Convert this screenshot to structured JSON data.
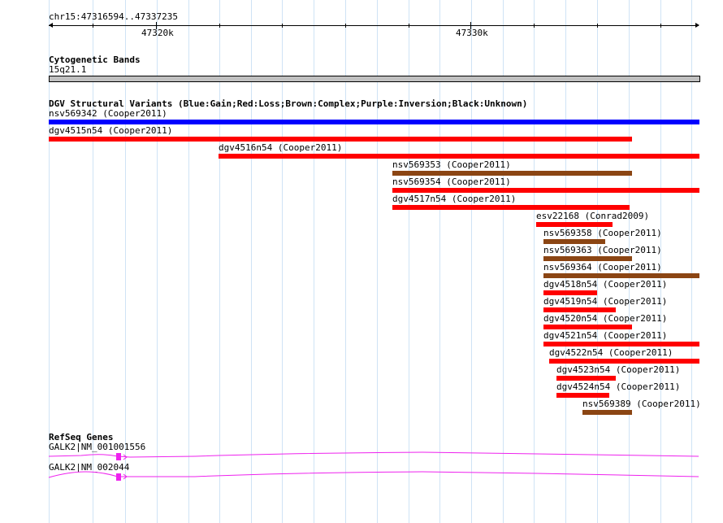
{
  "ruler": {
    "position_label": "chr15:47316594..47337235",
    "ticks": [
      "47320k",
      "47330k"
    ]
  },
  "cytoband_track": {
    "title": "Cytogenetic Bands",
    "band_label": "15q21.1",
    "band_color": "#c0c0c0"
  },
  "dgv_track": {
    "title": "DGV Structural Variants (Blue:Gain;Red:Loss;Brown:Complex;Purple:Inversion;Black:Unknown)",
    "colors": {
      "gain": "#0000ff",
      "loss": "#ff0000",
      "complex": "#8b4513"
    },
    "features": [
      {
        "label": "nsv569342 (Cooper2011)",
        "type": "gain"
      },
      {
        "label": "dgv4515n54 (Cooper2011)",
        "type": "loss"
      },
      {
        "label": "dgv4516n54 (Cooper2011)",
        "type": "loss"
      },
      {
        "label": "nsv569353 (Cooper2011)",
        "type": "complex"
      },
      {
        "label": "nsv569354 (Cooper2011)",
        "type": "loss"
      },
      {
        "label": "dgv4517n54 (Cooper2011)",
        "type": "loss"
      },
      {
        "label": "esv22168 (Conrad2009)",
        "type": "loss"
      },
      {
        "label": "nsv569358 (Cooper2011)",
        "type": "complex"
      },
      {
        "label": "nsv569363 (Cooper2011)",
        "type": "complex"
      },
      {
        "label": "nsv569364 (Cooper2011)",
        "type": "complex"
      },
      {
        "label": "dgv4518n54 (Cooper2011)",
        "type": "loss"
      },
      {
        "label": "dgv4519n54 (Cooper2011)",
        "type": "loss"
      },
      {
        "label": "dgv4520n54 (Cooper2011)",
        "type": "loss"
      },
      {
        "label": "dgv4521n54 (Cooper2011)",
        "type": "loss"
      },
      {
        "label": "dgv4522n54 (Cooper2011)",
        "type": "loss"
      },
      {
        "label": "dgv4523n54 (Cooper2011)",
        "type": "loss"
      },
      {
        "label": "dgv4524n54 (Cooper2011)",
        "type": "loss"
      },
      {
        "label": "nsv569389 (Cooper2011)",
        "type": "complex"
      }
    ]
  },
  "refseq_track": {
    "title": "RefSeq Genes",
    "gene_color": "#ee22ee",
    "genes": [
      {
        "label": "GALK2|NM_001001556"
      },
      {
        "label": "GALK2|NM_002044"
      }
    ]
  }
}
